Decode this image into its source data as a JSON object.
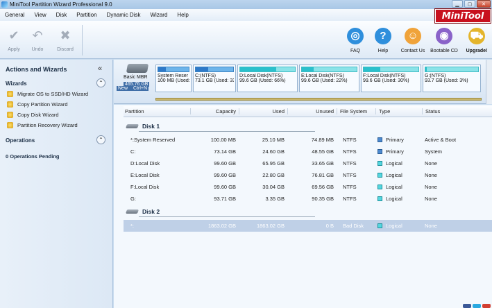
{
  "window": {
    "title": "MiniTool Partition Wizard Professional 9.0"
  },
  "brand": {
    "mini": "Mini",
    "tool": "Tool"
  },
  "menu": [
    "General",
    "View",
    "Disk",
    "Partition",
    "Dynamic Disk",
    "Wizard",
    "Help"
  ],
  "toolbar": {
    "left": [
      {
        "label": "Apply",
        "icon": "check-icon"
      },
      {
        "label": "Undo",
        "icon": "undo-icon"
      },
      {
        "label": "Discard",
        "icon": "discard-x-icon"
      }
    ],
    "right": [
      {
        "label": "FAQ",
        "icon": "lifebuoy-icon",
        "color": "#2f8fdc"
      },
      {
        "label": "Help",
        "icon": "question-icon",
        "color": "#2f8fdc"
      },
      {
        "label": "Contact Us",
        "icon": "person-icon",
        "color": "#f0a33a"
      },
      {
        "label": "Bootable CD",
        "icon": "cd-icon",
        "color": "#8a63c9"
      },
      {
        "label": "Upgrade!",
        "icon": "cart-icon",
        "color": "#e4b52c"
      }
    ]
  },
  "sidebar": {
    "title": "Actions and Wizards",
    "collapse_glyph": "«",
    "wizards_label": "Wizards",
    "wizards": [
      "Migrate OS to SSD/HD Wizard",
      "Copy Partition Wizard",
      "Copy Disk Wizard",
      "Partition Recovery Wizard"
    ],
    "operations_label": "Operations",
    "pending": "0 Operations Pending",
    "toggle_glyph": "⌃"
  },
  "diskmap": {
    "disk_label": "Basic MBR",
    "disk_size": "465.76 GB",
    "tooltip_new": "New",
    "tooltip_shortcut": "Ctrl+N",
    "blocks": [
      {
        "name": "System Reser",
        "info": "100 MB (Used:",
        "used": 0.25,
        "type": "primary"
      },
      {
        "name": "C:(NTFS)",
        "info": "73.1 GB (Used: 33",
        "used": 0.34,
        "type": "primary"
      },
      {
        "name": "D:Local Disk(NTFS)",
        "info": "99.6 GB (Used: 66%)",
        "used": 0.66,
        "type": "logical"
      },
      {
        "name": "E:Local Disk(NTFS)",
        "info": "99.6 GB (Used: 22%)",
        "used": 0.22,
        "type": "logical"
      },
      {
        "name": "F:Local Disk(NTFS)",
        "info": "99.6 GB (Used: 30%)",
        "used": 0.3,
        "type": "logical"
      },
      {
        "name": "G:(NTFS)",
        "info": "93.7 GB (Used: 3%)",
        "used": 0.03,
        "type": "logical"
      }
    ]
  },
  "table": {
    "columns": [
      "Partition",
      "Capacity",
      "Used",
      "Unused",
      "File System",
      "Type",
      "Status"
    ],
    "disk1": "Disk 1",
    "disk2": "Disk 2",
    "rows1": [
      {
        "partition": "*:System Reserved",
        "capacity": "100.00 MB",
        "used": "25.10 MB",
        "unused": "74.89 MB",
        "fs": "NTFS",
        "type": "Primary",
        "status": "Active & Boot",
        "kind": "primary"
      },
      {
        "partition": "C:",
        "capacity": "73.14 GB",
        "used": "24.60 GB",
        "unused": "48.55 GB",
        "fs": "NTFS",
        "type": "Primary",
        "status": "System",
        "kind": "primary"
      },
      {
        "partition": "D:Local Disk",
        "capacity": "99.60 GB",
        "used": "65.95 GB",
        "unused": "33.65 GB",
        "fs": "NTFS",
        "type": "Logical",
        "status": "None",
        "kind": "logical"
      },
      {
        "partition": "E:Local Disk",
        "capacity": "99.60 GB",
        "used": "22.80 GB",
        "unused": "76.81 GB",
        "fs": "NTFS",
        "type": "Logical",
        "status": "None",
        "kind": "logical"
      },
      {
        "partition": "F:Local Disk",
        "capacity": "99.60 GB",
        "used": "30.04 GB",
        "unused": "69.56 GB",
        "fs": "NTFS",
        "type": "Logical",
        "status": "None",
        "kind": "logical"
      },
      {
        "partition": "G:",
        "capacity": "93.71 GB",
        "used": "3.35 GB",
        "unused": "90.35 GB",
        "fs": "NTFS",
        "type": "Logical",
        "status": "None",
        "kind": "logical"
      }
    ],
    "rows2": [
      {
        "partition": "*:",
        "capacity": "1863.02 GB",
        "used": "1863.02 GB",
        "unused": "0 B",
        "fs": "Bad Disk",
        "type": "Logical",
        "status": "None",
        "kind": "logical"
      }
    ]
  }
}
